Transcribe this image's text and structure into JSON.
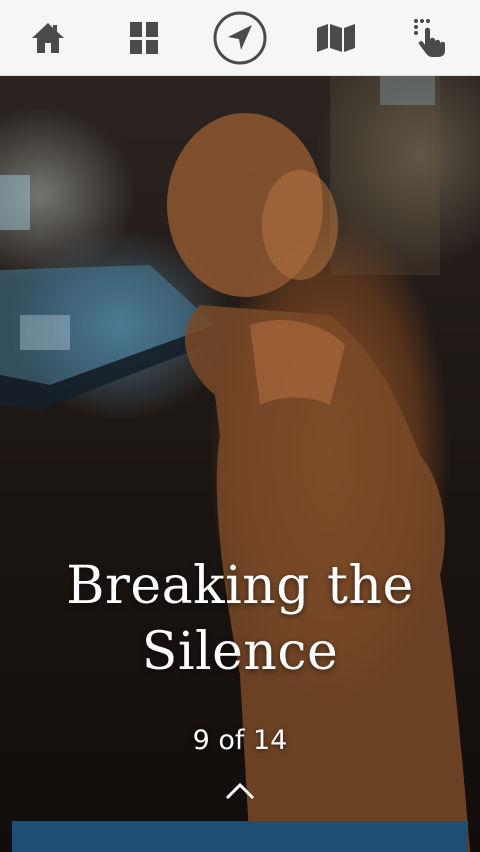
{
  "toolbar": {
    "items": [
      {
        "name": "home",
        "icon": "home-icon"
      },
      {
        "name": "grid",
        "icon": "grid-icon"
      },
      {
        "name": "navigate",
        "icon": "navigation-arrow-icon"
      },
      {
        "name": "map",
        "icon": "map-icon"
      },
      {
        "name": "touch",
        "icon": "tap-hand-icon"
      }
    ],
    "icon_color": "#4a4a4a"
  },
  "story": {
    "title": "Breaking the Silence",
    "counter": "9 of 14"
  },
  "colors": {
    "bottom_bar": "#1e4f73",
    "text": "#ffffff"
  }
}
